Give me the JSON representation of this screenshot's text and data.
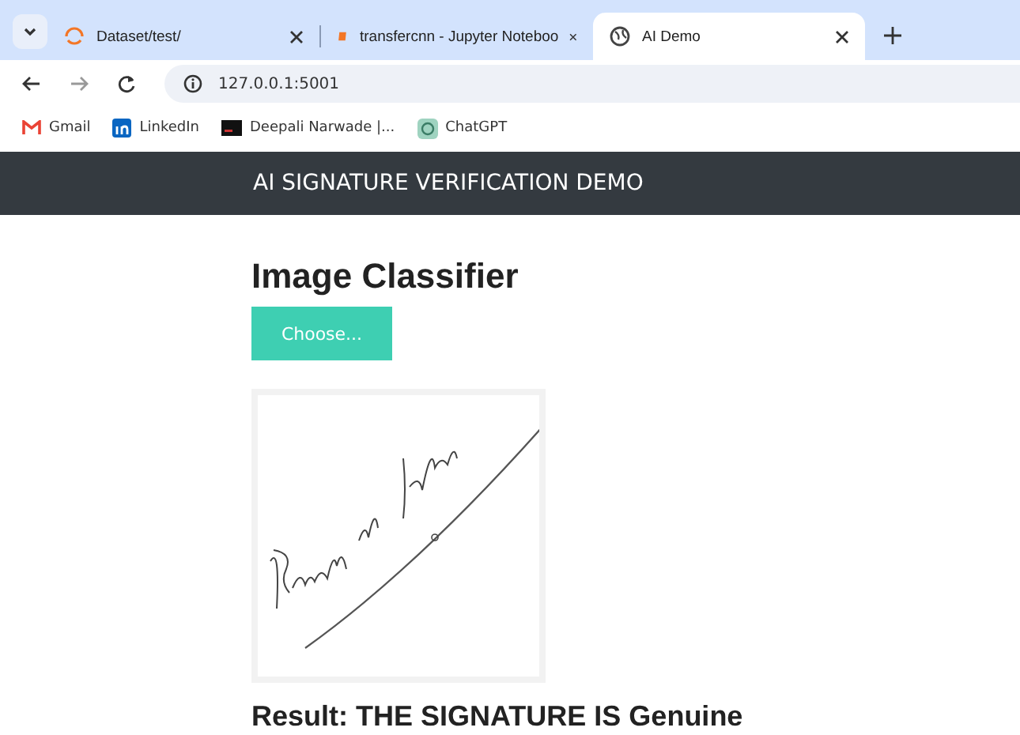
{
  "browser": {
    "tabs": [
      {
        "title": "Dataset/test/",
        "kind": "spinner",
        "selected": false
      },
      {
        "title": "transfercnn - Jupyter Noteboo",
        "kind": "notebook",
        "selected": false
      },
      {
        "title": "AI Demo",
        "kind": "globe",
        "selected": true
      }
    ],
    "address": "127.0.0.1:5001",
    "bookmarks": [
      {
        "label": "Gmail",
        "kind": "gmail"
      },
      {
        "label": "LinkedIn",
        "kind": "linkedin"
      },
      {
        "label": "Deepali Narwade |...",
        "kind": "terminal"
      },
      {
        "label": "ChatGPT",
        "kind": "chatgpt"
      }
    ]
  },
  "navbar": {
    "title": "AI SIGNATURE VERIFICATION DEMO"
  },
  "heading": "Image Classifier",
  "choose_button": "Choose...",
  "result": "Result: THE SIGNATURE IS Genuine"
}
